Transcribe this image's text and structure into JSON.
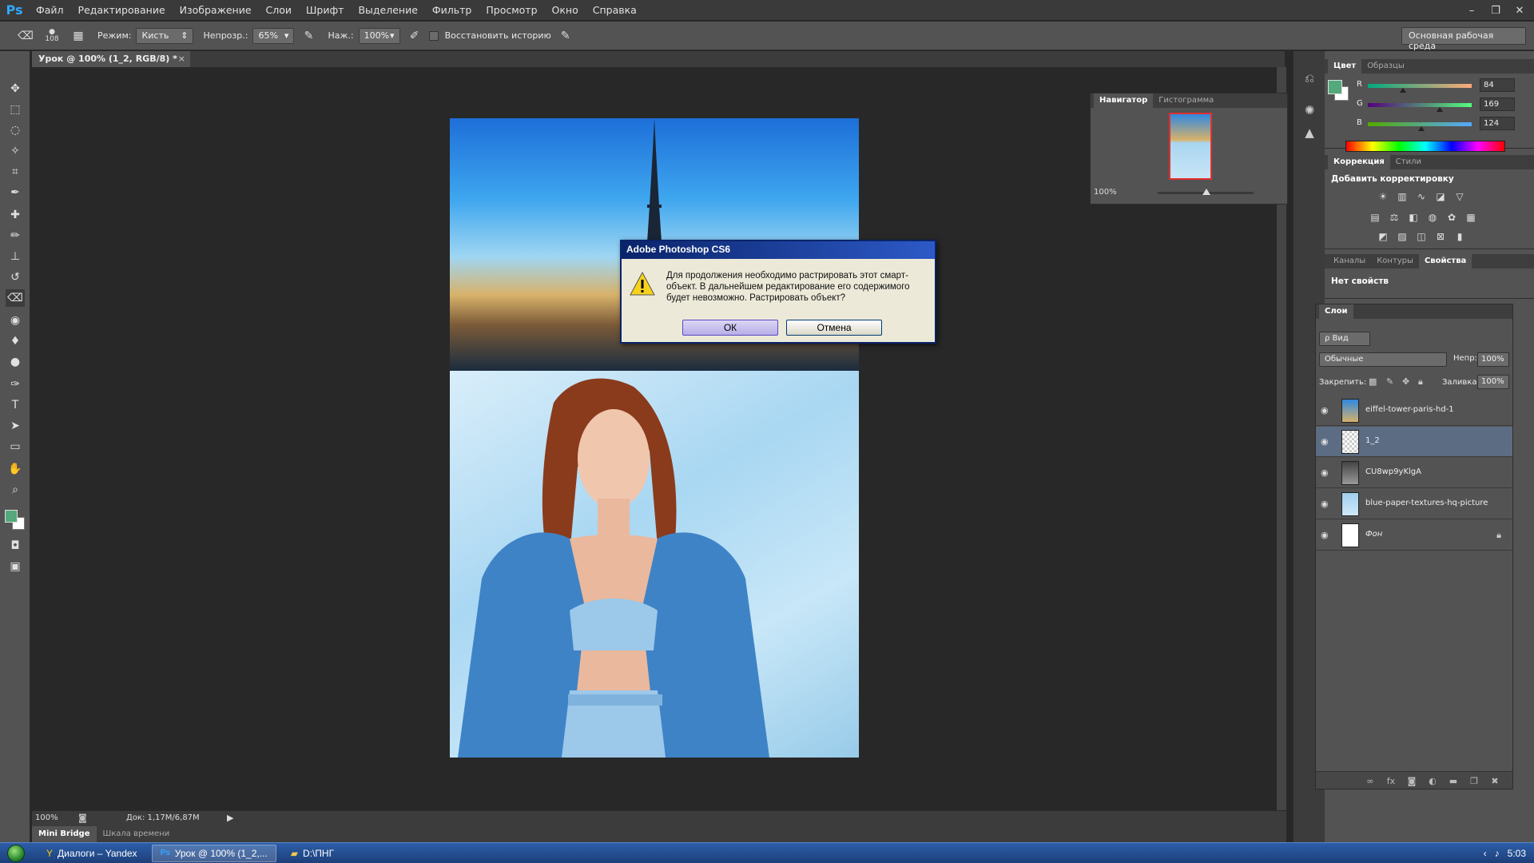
{
  "app": {
    "logo": "Ps",
    "menu": [
      "Файл",
      "Редактирование",
      "Изображение",
      "Слои",
      "Шрифт",
      "Выделение",
      "Фильтр",
      "Просмотр",
      "Окно",
      "Справка"
    ],
    "window_controls": [
      "–",
      "❐",
      "✕"
    ]
  },
  "options_bar": {
    "brush_size": "108",
    "mode_label": "Режим:",
    "mode_value": "Кисть",
    "opacity_label": "Непрозр.:",
    "opacity_value": "65%",
    "pressure_label": "Наж.:",
    "pressure_value": "100%",
    "restore_history_label": "Восстановить историю",
    "workspace": "Основная рабочая среда"
  },
  "document": {
    "tab_title": "Урок @ 100% (1_2, RGB/8) *",
    "close": "×",
    "zoom": "100%",
    "doc_size": "Док: 1,17M/6,87M",
    "arrow": "▶"
  },
  "dialog": {
    "title": "Adobe Photoshop CS6",
    "message": "Для продолжения необходимо растрировать этот смарт-объект.  В дальнейшем редактирование его содержимого будет невозможно. Растрировать объект?",
    "ok": "ОК",
    "cancel": "Отмена"
  },
  "navigator": {
    "tabs": [
      "Навигатор",
      "Гистограмма"
    ],
    "zoom": "100%"
  },
  "color_panel": {
    "tabs": [
      "Цвет",
      "Образцы"
    ],
    "fg_color": "#54a97c",
    "bg_color": "#ffffff",
    "channels": [
      {
        "label": "R",
        "value": "84"
      },
      {
        "label": "G",
        "value": "169"
      },
      {
        "label": "B",
        "value": "124"
      }
    ]
  },
  "adjustments_panel": {
    "tabs": [
      "Коррекция",
      "Стили"
    ],
    "title": "Добавить корректировку"
  },
  "properties_panel": {
    "tabs": [
      "Каналы",
      "Контуры",
      "Свойства"
    ],
    "text": "Нет свойств"
  },
  "layers_panel": {
    "title": "Слои",
    "filter": "ρ Вид",
    "blend_mode": "Обычные",
    "opacity_label": "Непр:",
    "opacity_value": "100%",
    "lock_label": "Закрепить:",
    "fill_label": "Заливка:",
    "fill_value": "100%",
    "layers": [
      {
        "name": "eiffel-tower-paris-hd-1",
        "selected": false
      },
      {
        "name": "1_2",
        "selected": true
      },
      {
        "name": "CU8wp9yKlgA",
        "selected": false
      },
      {
        "name": "blue-paper-textures-hq-picture",
        "selected": false
      },
      {
        "name": "Фон",
        "selected": false
      }
    ]
  },
  "bottom_tabs": [
    "Mini Bridge",
    "Шкала времени"
  ],
  "taskbar": {
    "items": [
      "Диалоги – Yandex",
      "Урок @ 100% (1_2,...",
      "D:\\ПНГ"
    ],
    "clock": "5:03"
  }
}
